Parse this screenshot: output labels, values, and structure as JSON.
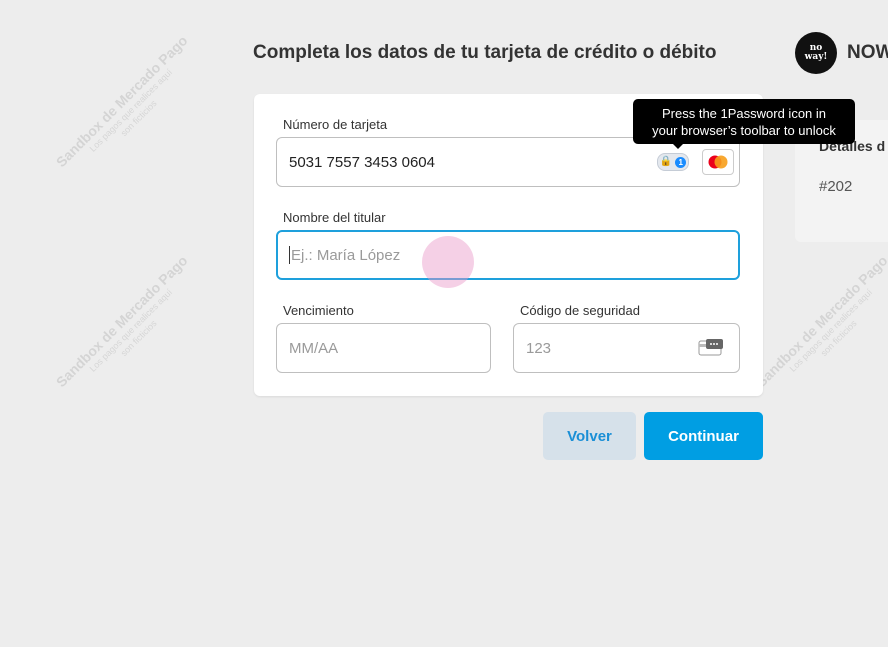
{
  "page": {
    "title": "Completa los datos de tu tarjeta de crédito o débito"
  },
  "watermark": {
    "line1": "Sandbox de Mercado Pago",
    "line2": "Los pagos que realices aquí",
    "line3": "son ficticios"
  },
  "store": {
    "logo_line1": "no",
    "logo_line2": "way!",
    "name": "NOW"
  },
  "side_card": {
    "title": "Detalles d",
    "order": "#202"
  },
  "form": {
    "card_number": {
      "label": "Número de tarjeta",
      "value": "5031 7557 3453 0604"
    },
    "holder": {
      "label": "Nombre del titular",
      "placeholder": "Ej.: María López"
    },
    "expiry": {
      "label": "Vencimiento",
      "placeholder": "MM/AA"
    },
    "cvv": {
      "label": "Código de seguridad",
      "placeholder": "123"
    }
  },
  "tooltip": {
    "line1": "Press the 1Password icon in",
    "line2": "your browser’s toolbar to unlock"
  },
  "buttons": {
    "back": "Volver",
    "continue": "Continuar"
  },
  "icons": {
    "password_manager": "1password-lock-icon",
    "card_brand": "mastercard-icon",
    "cvv": "cvv-card-icon"
  },
  "colors": {
    "accent": "#009ee3",
    "focus": "#1ea0dc",
    "secondary_button": "#d6e1ea"
  }
}
